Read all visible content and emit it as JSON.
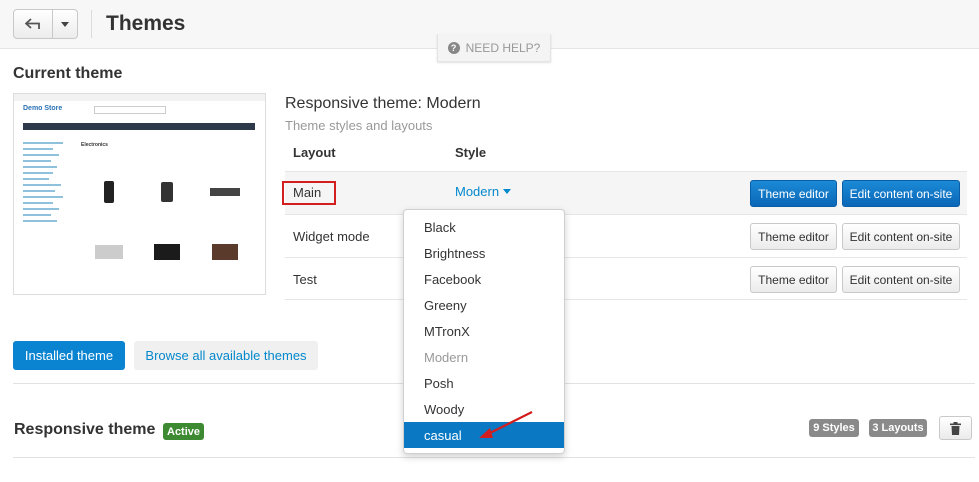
{
  "header": {
    "title": "Themes",
    "help": "NEED HELP?"
  },
  "current": {
    "section_title": "Current theme",
    "theme_name": "Responsive theme: Modern",
    "theme_subtitle": "Theme styles and layouts",
    "col_layout": "Layout",
    "col_style": "Style",
    "rows": [
      {
        "name": "Main",
        "style": "Modern",
        "btn1": "Theme editor",
        "btn2": "Edit content on-site"
      },
      {
        "name": "Widget mode",
        "btn1": "Theme editor",
        "btn2": "Edit content on-site"
      },
      {
        "name": "Test",
        "btn1": "Theme editor",
        "btn2": "Edit content on-site"
      }
    ],
    "preview": {
      "logo": "Demo Store",
      "heading": "Electronics"
    }
  },
  "dropdown": {
    "items": [
      "Black",
      "Brightness",
      "Facebook",
      "Greeny",
      "MTronX",
      "Modern",
      "Posh",
      "Woody",
      "casual"
    ],
    "disabled": "Modern",
    "selected": "casual"
  },
  "tabs": {
    "installed": "Installed theme",
    "browse": "Browse all available themes"
  },
  "installed": {
    "title": "Responsive theme",
    "active_badge": "Active",
    "styles_badge": "9 Styles",
    "layouts_badge": "3 Layouts"
  },
  "colors": {
    "primary": "#0a84d0",
    "link": "#0388cc",
    "active": "#3e8a32",
    "highlight_box": "#d21e1e",
    "arrow": "#d21e1e"
  }
}
